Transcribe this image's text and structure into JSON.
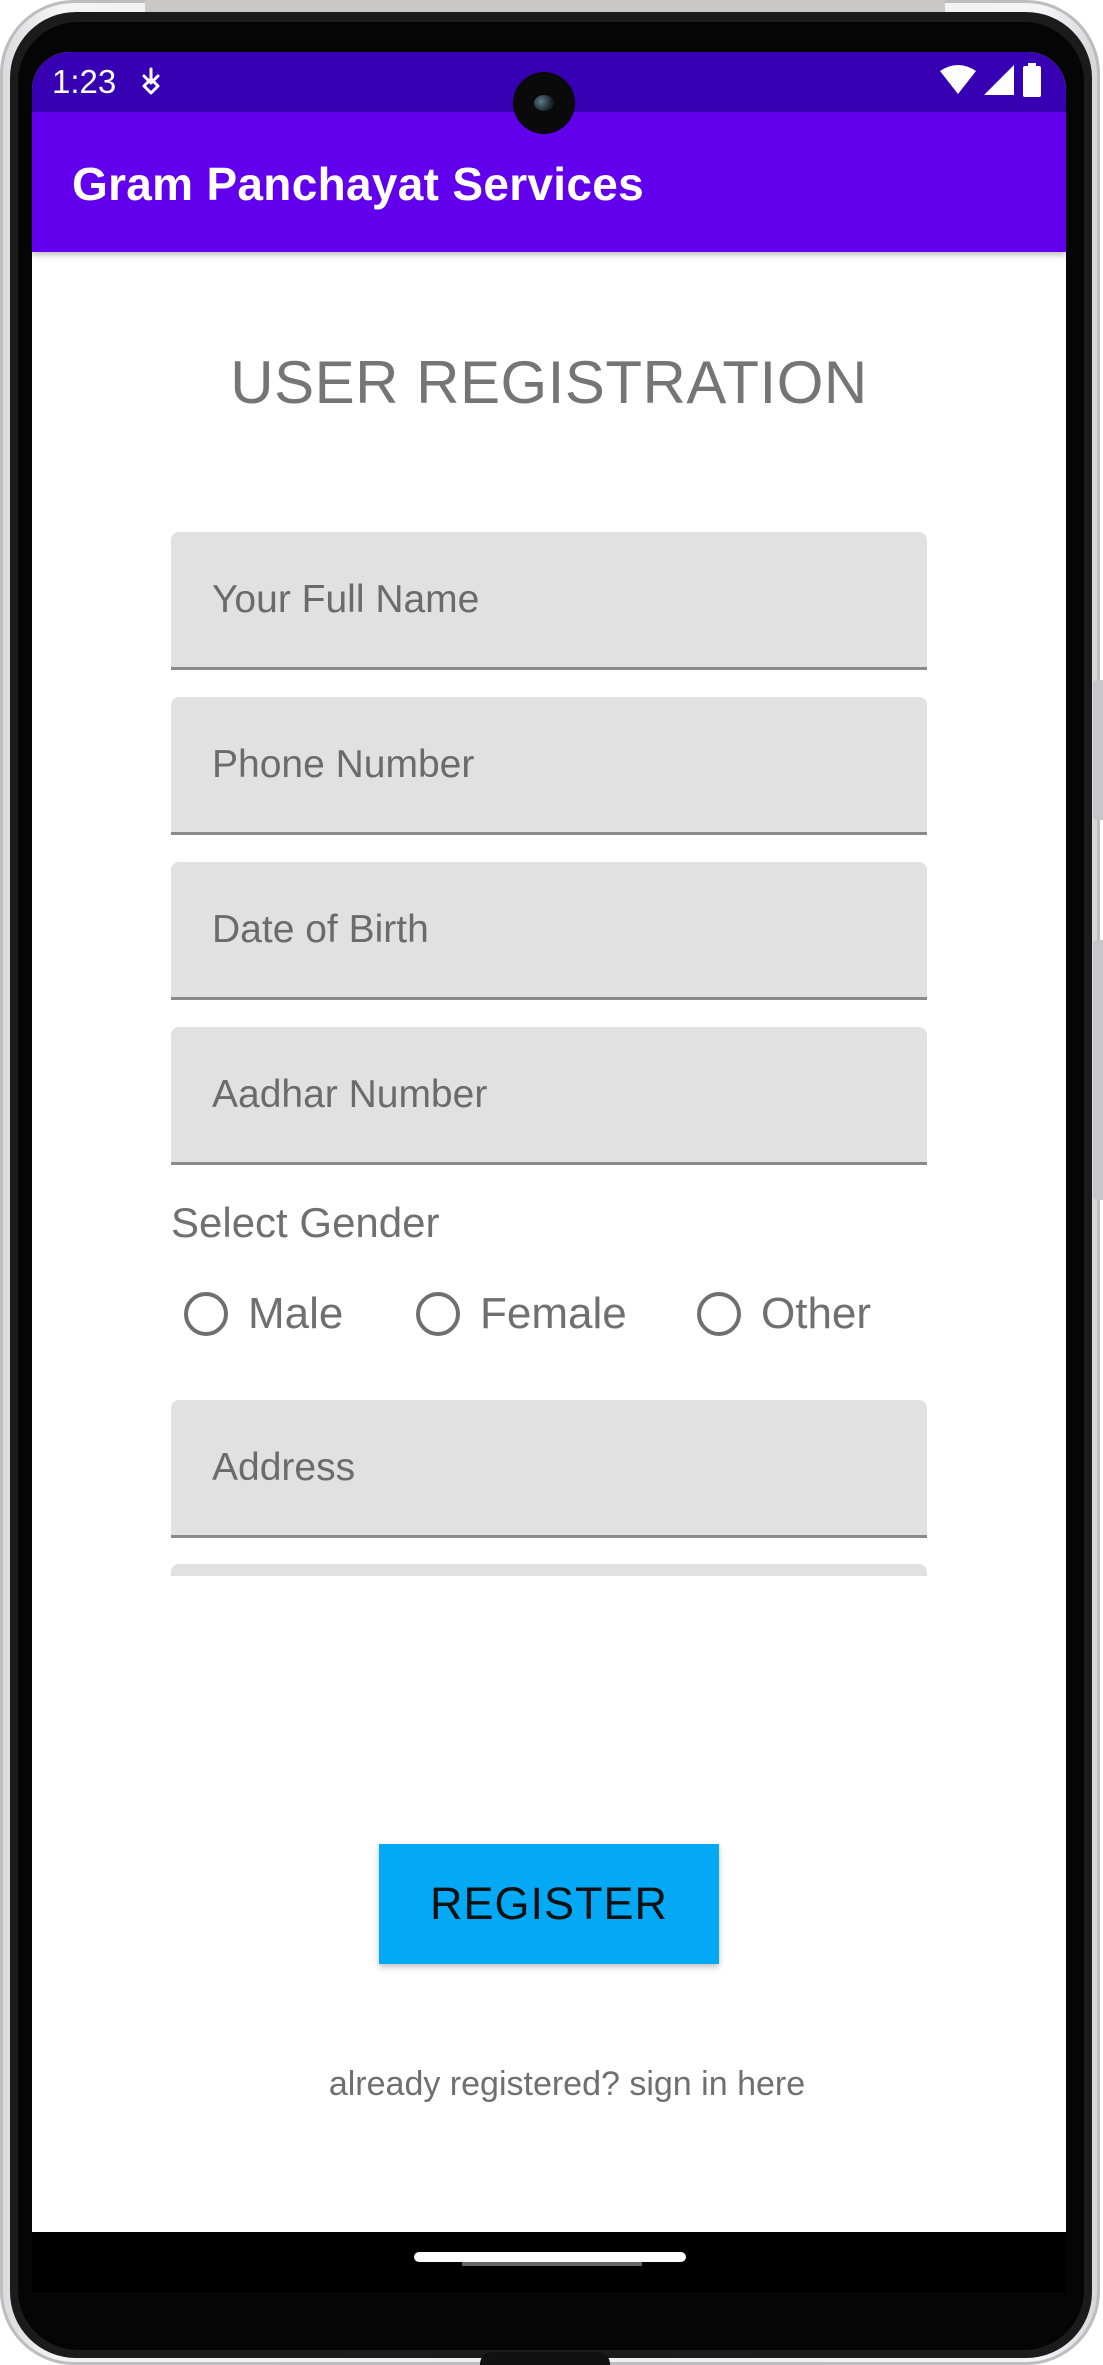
{
  "status_bar": {
    "time": "1:23",
    "notification_icon": "download-arrow-icon",
    "wifi_icon": "wifi-icon",
    "signal_icon": "signal-icon",
    "battery_icon": "battery-icon",
    "background": "#3700b3"
  },
  "app_bar": {
    "title": "Gram Panchayat Services",
    "background": "#6200ee"
  },
  "form": {
    "heading": "USER REGISTRATION",
    "fields": {
      "full_name": {
        "placeholder": "Your Full Name",
        "value": ""
      },
      "phone": {
        "placeholder": "Phone Number",
        "value": ""
      },
      "dob": {
        "placeholder": "Date of Birth",
        "value": ""
      },
      "aadhar": {
        "placeholder": "Aadhar Number",
        "value": ""
      },
      "address": {
        "placeholder": "Address",
        "value": ""
      }
    },
    "gender": {
      "label": "Select Gender",
      "options": [
        "Male",
        "Female",
        "Other"
      ],
      "selected": null
    },
    "register_label": "REGISTER",
    "register_color": "#03a9f4",
    "signin_link": "already registered? sign in here"
  }
}
